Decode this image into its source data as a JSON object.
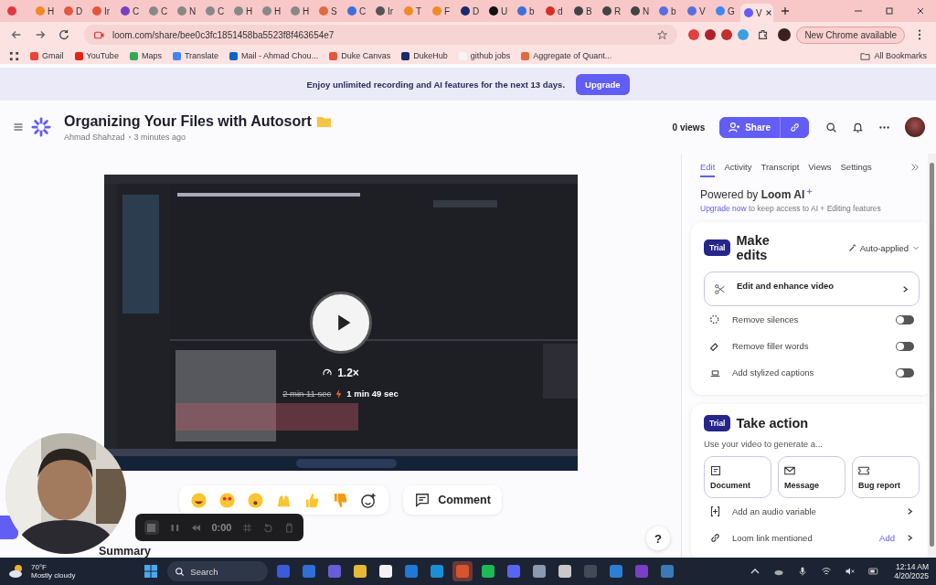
{
  "browser": {
    "tabs": [
      {
        "color": "#e0383e",
        "selected": false
      },
      {
        "label": "H",
        "color": "#f08a24",
        "selected": false
      },
      {
        "label": "D",
        "color": "#e0583e",
        "selected": false
      },
      {
        "label": "Ir",
        "color": "#e0583e",
        "selected": false
      },
      {
        "label": "C",
        "color": "#7b3fc4",
        "selected": false
      },
      {
        "label": "C",
        "color": "#888888",
        "selected": false
      },
      {
        "label": "N",
        "color": "#888888",
        "selected": false
      },
      {
        "label": "C",
        "color": "#888888",
        "selected": false
      },
      {
        "label": "H",
        "color": "#888888",
        "selected": false
      },
      {
        "label": "H",
        "color": "#888888",
        "selected": false
      },
      {
        "label": "H",
        "color": "#888888",
        "selected": false
      },
      {
        "label": "S",
        "color": "#e06b3e",
        "selected": false
      },
      {
        "label": "C",
        "color": "#3f6fd8",
        "selected": false
      },
      {
        "label": "Ir",
        "color": "#555555",
        "selected": false
      },
      {
        "label": "T",
        "color": "#f08a24",
        "selected": false
      },
      {
        "label": "F",
        "color": "#f08a24",
        "selected": false
      },
      {
        "label": "D",
        "color": "#1a2a6c",
        "selected": false
      },
      {
        "label": "U",
        "color": "#111111",
        "selected": false
      },
      {
        "label": "b",
        "color": "#3f6fd8",
        "selected": false
      },
      {
        "label": "d",
        "color": "#d93025",
        "selected": false
      },
      {
        "label": "B",
        "color": "#444444",
        "selected": false
      },
      {
        "label": "R",
        "color": "#444444",
        "selected": false
      },
      {
        "label": "N",
        "color": "#444444",
        "selected": false
      },
      {
        "label": "b",
        "color": "#5a6ee0",
        "selected": false
      },
      {
        "label": "V",
        "color": "#5a6ee0",
        "selected": false
      },
      {
        "label": "G",
        "color": "#4285f4",
        "selected": false
      },
      {
        "label": "V",
        "color": "#625df5",
        "selected": true
      }
    ],
    "url": "loom.com/share/bee0c3fc1851458ba5523f8f463654e7",
    "new_chrome": "New Chrome available",
    "bookmarks": [
      {
        "label": "Gmail",
        "color": "#ea4335"
      },
      {
        "label": "YouTube",
        "color": "#e62117"
      },
      {
        "label": "Maps",
        "color": "#34a853"
      },
      {
        "label": "Translate",
        "color": "#4285f4"
      },
      {
        "label": "Mail - Ahmad Chou...",
        "color": "#0a64c8"
      },
      {
        "label": "Duke Canvas",
        "color": "#e0583e"
      },
      {
        "label": "DukeHub",
        "color": "#1a2a6c"
      },
      {
        "label": "github jobs",
        "color": "#f5f5f5"
      },
      {
        "label": "Aggregate of Quant...",
        "color": "#e06b3e"
      }
    ],
    "all_bookmarks": "All Bookmarks"
  },
  "banner": {
    "text": "Enjoy unlimited recording and AI features for the next 13 days.",
    "button": "Upgrade"
  },
  "header": {
    "title": "Organizing Your Files with Autosort",
    "author": "Ahmad Shahzad",
    "time": "3 minutes ago",
    "views": "0 views",
    "share": "Share"
  },
  "video": {
    "speed": "1.2×",
    "original": "2 min 11 sec",
    "shortened": "1 min 49 sec"
  },
  "comment": "Comment",
  "recorder": {
    "time": "0:00"
  },
  "summary": "Summary",
  "help": "?",
  "panel": {
    "tabs": [
      {
        "label": "Edit",
        "selected": true
      },
      {
        "label": "Activity",
        "selected": false
      },
      {
        "label": "Transcript",
        "selected": false
      },
      {
        "label": "Views",
        "selected": false
      },
      {
        "label": "Settings",
        "selected": false
      }
    ],
    "powered": "Powered by **Loom AI**",
    "upgrade_link": "Upgrade now",
    "upgrade_rest": "to keep access to AI + Editing features",
    "edit_card": {
      "badge": "Trial",
      "title": "Make edits",
      "mode": "Auto-applied",
      "main": "Edit and enhance video",
      "options": [
        {
          "label": "Remove silences",
          "on": false
        },
        {
          "label": "Remove filler words",
          "on": false
        },
        {
          "label": "Add stylized captions",
          "on": false
        }
      ]
    },
    "action_card": {
      "badge": "Trial",
      "title": "Take action",
      "subtitle": "Use your video to generate a...",
      "buttons": [
        "Document",
        "Message",
        "Bug report"
      ],
      "rows": [
        {
          "label": "Add an audio variable"
        },
        {
          "label": "Loom link mentioned",
          "action": "Add"
        }
      ]
    }
  },
  "taskbar": {
    "temp": "70°F",
    "weather": "Mostly cloudy",
    "search": "Search",
    "time": "12:14 AM",
    "date": "4/20/2025"
  }
}
